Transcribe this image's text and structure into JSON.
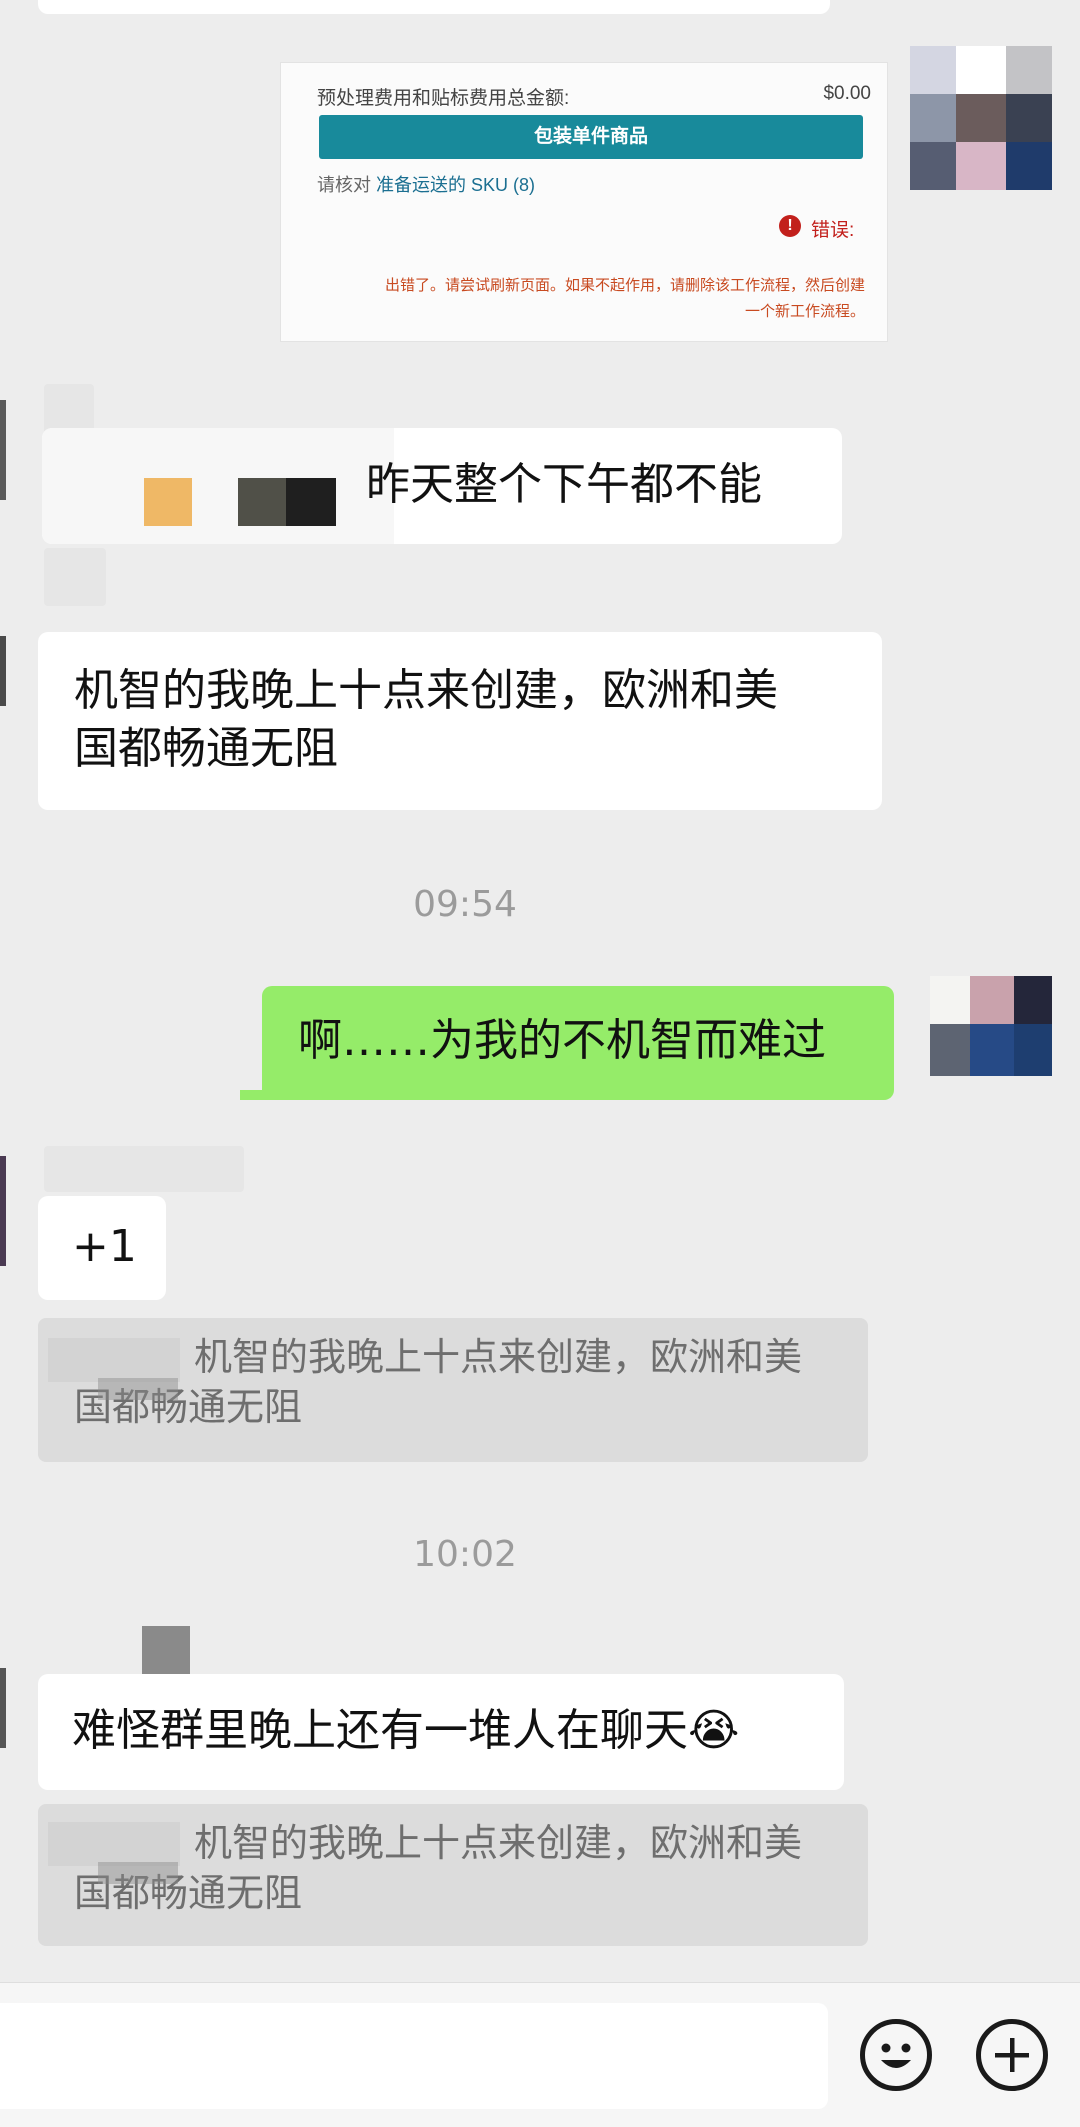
{
  "screenshot_card": {
    "fee_label": "预处理费用和贴标费用总金额:",
    "fee_amount": "$0.00",
    "pack_button": "包装单件商品",
    "check_prefix": "请核对",
    "check_link": "准备运送的 SKU (8)",
    "error_icon": "!",
    "error_label": "错误:",
    "error_message_line1": "出错了。请尝试刷新页面。如果不起作用，请删除该工作流程，然后创建",
    "error_message_line2": "一个新工作流程。"
  },
  "messages": [
    {
      "text": "昨天整个下午都不能"
    },
    {
      "text_line1": "机智的我晚上十点来创建，欧洲和美",
      "text_line2": "国都畅通无阻"
    },
    {
      "time": "09:54"
    },
    {
      "text": "啊……为我的不机智而难过"
    },
    {
      "text": "+1",
      "quote_line1": "机智的我晚上十点来创建，欧洲和美",
      "quote_line2": "国都畅通无阻"
    },
    {
      "time": "10:02"
    },
    {
      "text": "难怪群里晚上还有一堆人在聊天",
      "emoji": "😭",
      "quote_line1": "机智的我晚上十点来创建，欧洲和美",
      "quote_line2": "国都畅通无阻"
    }
  ],
  "input_bar": {
    "emoji_icon": "smiley-icon",
    "plus_icon": "plus-icon"
  },
  "colors": {
    "background": "#ededed",
    "my_bubble": "#95ec69",
    "other_bubble": "#ffffff",
    "quote_bg": "#dcdcdc",
    "button_teal": "#188a9b",
    "error_red": "#c2201c"
  }
}
